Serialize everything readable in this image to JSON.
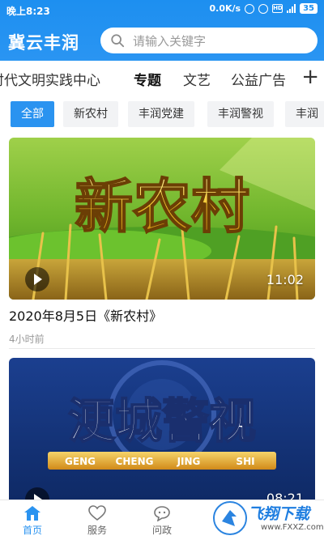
{
  "status_bar": {
    "time": "晚上8:23",
    "speed": "0.0K/s",
    "battery": "35"
  },
  "header": {
    "app_title": "冀云丰润",
    "search_placeholder": "请输入关键字"
  },
  "tabs": [
    {
      "label": "时代文明实践中心"
    },
    {
      "label": "专题",
      "active": true
    },
    {
      "label": "文艺"
    },
    {
      "label": "公益广告"
    }
  ],
  "tab_add_label": "+",
  "chips": [
    {
      "label": "全部",
      "active": true
    },
    {
      "label": "新农村"
    },
    {
      "label": "丰润党建"
    },
    {
      "label": "丰润警视"
    },
    {
      "label": "丰润"
    }
  ],
  "videos": [
    {
      "thumb_text": "新农村",
      "duration": "11:02",
      "title": "2020年8月5日《新农村》",
      "time_ago": "4小时前"
    },
    {
      "thumb_text": "浭城警视",
      "thumb_pinyin": [
        "GENG",
        "CHENG",
        "JING",
        "SHI"
      ],
      "duration": "08:21"
    }
  ],
  "bottom_nav": [
    {
      "label": "首页",
      "icon": "home-icon",
      "active": true
    },
    {
      "label": "服务",
      "icon": "heart-icon"
    },
    {
      "label": "问政",
      "icon": "chat-icon"
    }
  ],
  "watermark": {
    "text": "飞翔下载",
    "url": "www.FXXZ.com"
  },
  "colors": {
    "primary": "#2a93f0",
    "header": "#1d8ff0"
  }
}
